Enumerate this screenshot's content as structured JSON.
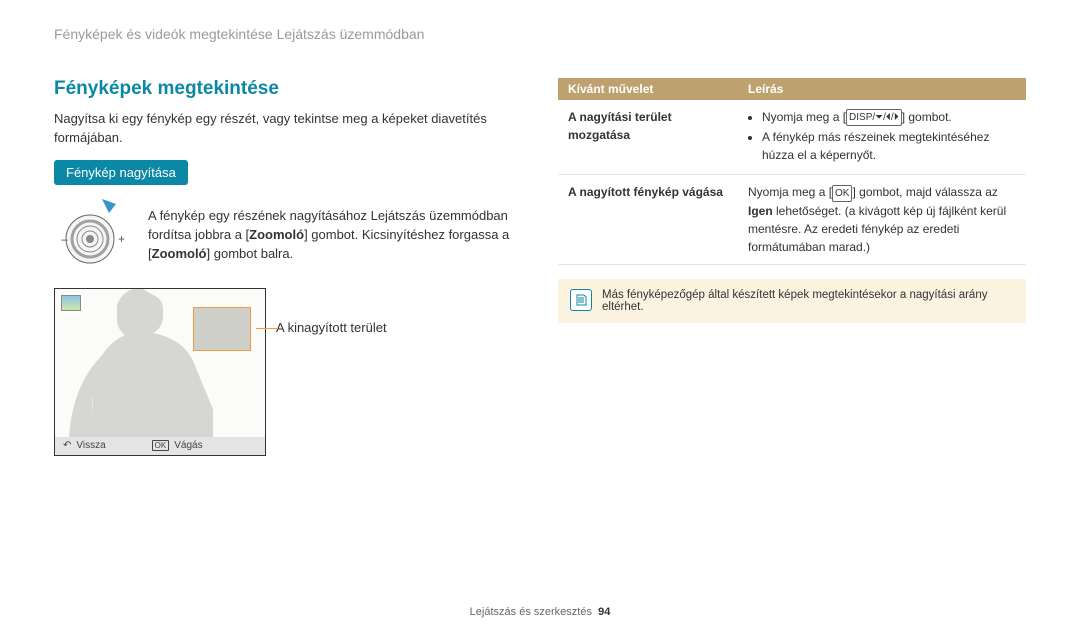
{
  "header": "Fényképek és videók megtekintése Lejátszás üzemmódban",
  "section_title": "Fényképek megtekintése",
  "intro": "Nagyítsa ki egy fénykép egy részét, vagy tekintse meg a képeket diavetítés formájában.",
  "pill": "Fénykép nagyítása",
  "zoom_para_pre": "A fénykép egy részének nagyításához Lejátszás üzemmódban fordítsa jobbra a [",
  "zoom_bold1": "Zoomoló",
  "zoom_para_mid": "] gombot. Kicsinyítéshez forgassa a [",
  "zoom_bold2": "Zoomoló",
  "zoom_para_post": "] gombot balra.",
  "crop_label": "A kinagyított terület",
  "status_back_label": "Vissza",
  "status_ok": "OK",
  "status_crop_label": "Vágás",
  "table": {
    "head_action": "Kívánt művelet",
    "head_desc": "Leírás",
    "rows": [
      {
        "action": "A nagyítási terület mozgatása",
        "desc_bullets": [
          {
            "pre": "Nyomja meg a [",
            "icons": "DISP/⏷/⏴/⏵",
            "post": "] gombot."
          },
          {
            "text": "A fénykép más részeinek megtekintéséhez húzza el a képernyőt."
          }
        ]
      },
      {
        "action": "A nagyított fénykép vágása",
        "desc_pre": "Nyomja meg a [",
        "desc_icon": "OK",
        "desc_mid": "] gombot, majd válassza az ",
        "desc_bold": "Igen",
        "desc_post": " lehetőséget. (a kivágott kép új fájlként kerül mentésre. Az eredeti fénykép az eredeti formátumában marad.)"
      }
    ]
  },
  "note": "Más fényképezőgép által készített képek megtekintésekor a nagyítási arány eltérhet.",
  "footer_label": "Lejátszás és szerkesztés",
  "footer_page": "94"
}
